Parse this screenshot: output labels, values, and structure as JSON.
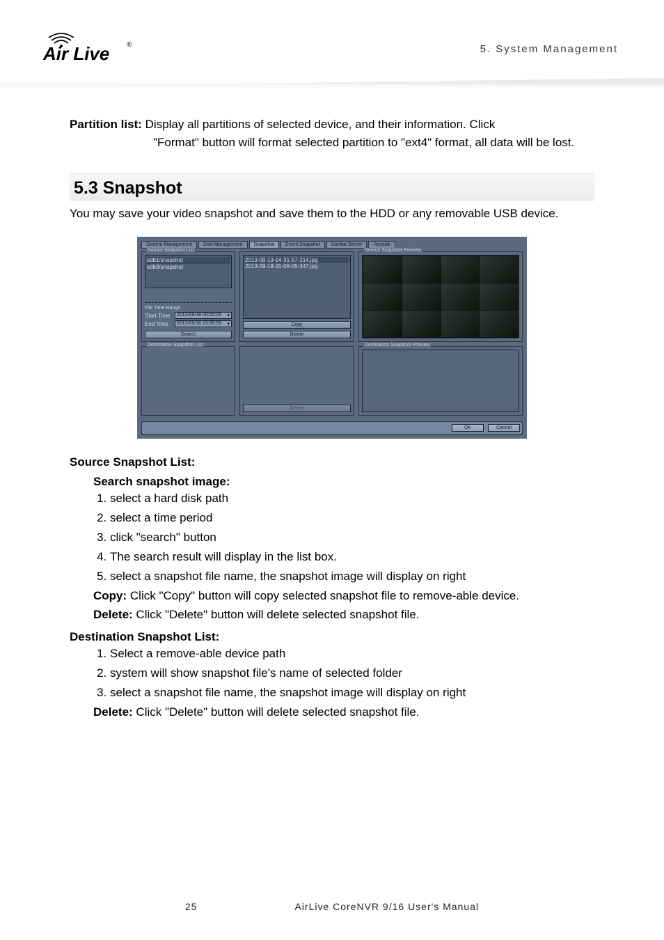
{
  "chapter_label": "5. System Management",
  "logo_text": "Air Live",
  "partition_list": {
    "label": "Partition list:",
    "line1": "Display all partitions of selected device, and their information. Click",
    "line2": "\"Format\" button will format selected partition to \"ext4\" format, all data will be lost."
  },
  "section_heading": "5.3 Snapshot",
  "section_intro": "You may save your video snapshot and save them to the HDD or any removable USB device.",
  "screenshot": {
    "tabs": [
      "System Management",
      "Disk Management",
      "Snapshot",
      "Event Snapshot",
      "Samba Server",
      "Joystick"
    ],
    "active_tab_index": 2,
    "source_snapshot_list": {
      "legend": "Source Snapshot List",
      "paths": [
        "sdb1/snapshot",
        "sdb3/snapshot"
      ],
      "file_time_range_legend": "File Time Range",
      "start_label": "Start Time",
      "start_value": "2013/09/18 00:00:00",
      "end_label": "End Time",
      "end_value": "2013/09/18 23:59:59",
      "search_btn": "Search"
    },
    "file_list": {
      "files": [
        "2013-09-13-14-31-57-214.jpg",
        "2013-09-18-15-06-05-347.jpg"
      ],
      "copy_btn": "Copy",
      "delete_btn": "Delete"
    },
    "source_preview_legend": "Source Snapshot Preview",
    "destination_snapshot_list_legend": "Destination Snapshot List",
    "destination_delete_btn": "Delete",
    "destination_preview_legend": "Destination Snapshot Preview",
    "ok_btn": "OK",
    "cancel_btn": "Cancel"
  },
  "source_list_heading": "Source Snapshot List:",
  "search_heading": "Search snapshot image:",
  "search_steps": [
    "select a hard disk path",
    "select a time period",
    "click \"search\" button",
    "The search result will display in the list box.",
    "select a snapshot file name, the snapshot image will display on right"
  ],
  "copy_label": "Copy:",
  "copy_text": " Click \"Copy\" button will copy selected snapshot file to remove-able device.",
  "delete_label": "Delete:",
  "delete_text": " Click \"Delete\" button will delete selected snapshot file.",
  "dest_list_heading": "Destination Snapshot List:",
  "dest_steps": [
    "Select a remove-able device path",
    "system will show snapshot file's name of selected folder",
    "select a snapshot file name, the snapshot image will display on right"
  ],
  "dest_delete_label": "Delete:",
  "dest_delete_text": " Click \"Delete\" button will delete selected snapshot file.",
  "page_number": "25",
  "footer_text": "AirLive CoreNVR 9/16 User's Manual"
}
